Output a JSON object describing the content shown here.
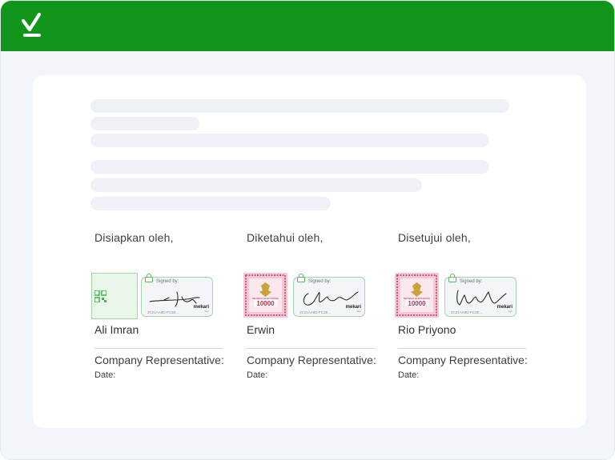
{
  "header": {
    "icon": "check-icon",
    "color": "#12951b"
  },
  "signatures": [
    {
      "role": "Disiapkan oleh,",
      "name": "Ali Imran",
      "signed_by": "Signed by:",
      "code": "2C21AA8D-FC3E...",
      "brand": "mekari",
      "brand_sub": "sign",
      "rep_label": "Company Representative:",
      "date_label": "Date:",
      "stamp": "qr-code-stamp"
    },
    {
      "role": "Diketahui oleh,",
      "name": "Erwin",
      "signed_by": "Signed by:",
      "code": "2C21AA8D-FC3E...",
      "brand": "mekari",
      "brand_sub": "sign",
      "rep_label": "Company Representative:",
      "date_label": "Date:",
      "stamp": "meterai-stamp",
      "stamp_label": "METERAI ELEKTRONIK",
      "stamp_value": "10000"
    },
    {
      "role": "Disetujui oleh,",
      "name": "Rio Priyono",
      "signed_by": "Signed by:",
      "code": "2C21AA8D-FC3E...",
      "brand": "mekari",
      "brand_sub": "sign",
      "rep_label": "Company Representative:",
      "date_label": "Date:",
      "stamp": "meterai-stamp",
      "stamp_label": "METERAI ELEKTRONIK",
      "stamp_value": "10000"
    }
  ]
}
